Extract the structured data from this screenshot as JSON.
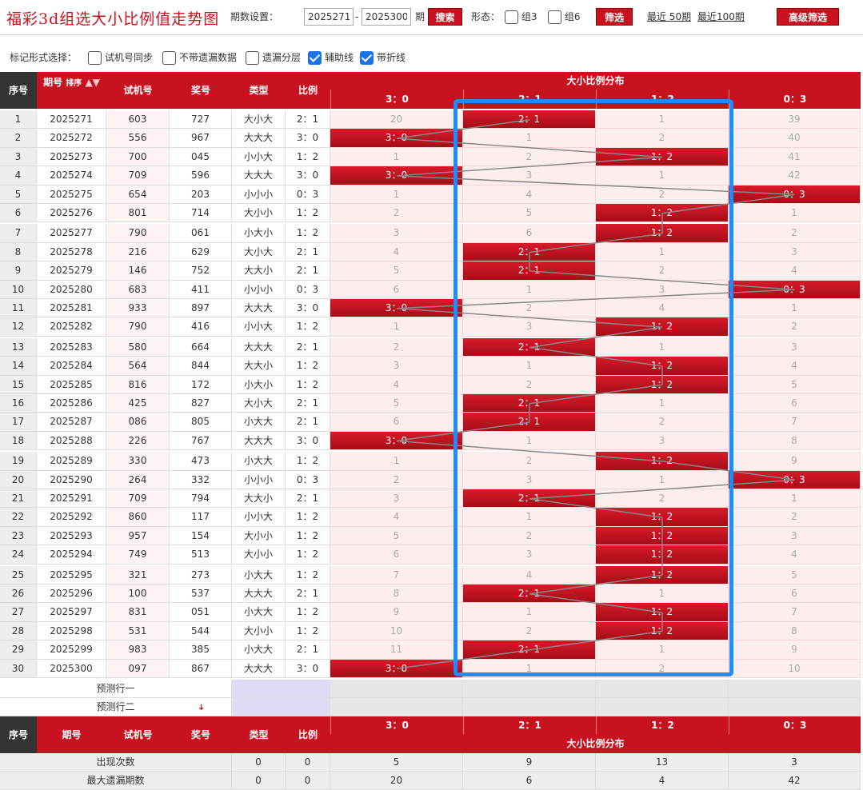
{
  "title": "福彩3d组选大小比例值走势图",
  "toolbar": {
    "period_label": "期数设置：",
    "from": "2025271",
    "to": "2025300",
    "period_suffix": "期",
    "search": "搜索",
    "form_label": "形态：",
    "group3": "组3",
    "group6": "组6",
    "filter": "筛选",
    "recent50": "最近 50期",
    "recent100": "最近100期",
    "advanced": "高级筛选"
  },
  "marks": {
    "label": "标记形式选择：",
    "opts": [
      {
        "label": "试机号同步",
        "checked": false
      },
      {
        "label": "不带遗漏数据",
        "checked": false
      },
      {
        "label": "遗漏分层",
        "checked": false
      },
      {
        "label": "辅助线",
        "checked": true
      },
      {
        "label": "带折线",
        "checked": true
      }
    ]
  },
  "header": {
    "seq": "序号",
    "period": "期号",
    "sort": "排序",
    "trial": "试机号",
    "prize": "奖号",
    "type": "类型",
    "ratio": "比例",
    "dist": "大小比例分布"
  },
  "ratios": [
    "3：0",
    "2：1",
    "1：2",
    "0：3"
  ],
  "rows": [
    [
      "1",
      "2025271",
      "603",
      "727",
      "大小大",
      "2：1",
      [
        20,
        -1,
        1,
        39
      ]
    ],
    [
      "2",
      "2025272",
      "556",
      "967",
      "大大大",
      "3：0",
      [
        -1,
        1,
        2,
        40
      ]
    ],
    [
      "3",
      "2025273",
      "700",
      "045",
      "小小大",
      "1：2",
      [
        1,
        2,
        -1,
        41
      ]
    ],
    [
      "4",
      "2025274",
      "709",
      "596",
      "大大大",
      "3：0",
      [
        -1,
        3,
        1,
        42
      ]
    ],
    [
      "5",
      "2025275",
      "654",
      "203",
      "小小小",
      "0：3",
      [
        1,
        4,
        2,
        -1
      ]
    ],
    [
      "6",
      "2025276",
      "801",
      "714",
      "大小小",
      "1：2",
      [
        2,
        5,
        -1,
        1
      ]
    ],
    [
      "7",
      "2025277",
      "790",
      "061",
      "小大小",
      "1：2",
      [
        3,
        6,
        -1,
        2
      ]
    ],
    [
      "8",
      "2025278",
      "216",
      "629",
      "大小大",
      "2：1",
      [
        4,
        -1,
        1,
        3
      ]
    ],
    [
      "9",
      "2025279",
      "146",
      "752",
      "大大小",
      "2：1",
      [
        5,
        -1,
        2,
        4
      ]
    ],
    [
      "10",
      "2025280",
      "683",
      "411",
      "小小小",
      "0：3",
      [
        6,
        1,
        3,
        -1
      ]
    ],
    [
      "11",
      "2025281",
      "933",
      "897",
      "大大大",
      "3：0",
      [
        -1,
        2,
        4,
        1
      ]
    ],
    [
      "12",
      "2025282",
      "790",
      "416",
      "小小大",
      "1：2",
      [
        1,
        3,
        -1,
        2
      ]
    ],
    [
      "13",
      "2025283",
      "580",
      "664",
      "大大大",
      "2：1",
      [
        2,
        -1,
        1,
        3
      ]
    ],
    [
      "14",
      "2025284",
      "564",
      "844",
      "大大小",
      "1：2",
      [
        3,
        1,
        -1,
        4
      ]
    ],
    [
      "15",
      "2025285",
      "816",
      "172",
      "小大小",
      "1：2",
      [
        4,
        2,
        -1,
        5
      ]
    ],
    [
      "16",
      "2025286",
      "425",
      "827",
      "大小大",
      "2：1",
      [
        5,
        -1,
        1,
        6
      ]
    ],
    [
      "17",
      "2025287",
      "086",
      "805",
      "小大大",
      "2：1",
      [
        6,
        -1,
        2,
        7
      ]
    ],
    [
      "18",
      "2025288",
      "226",
      "767",
      "大大大",
      "3：0",
      [
        -1,
        1,
        3,
        8
      ]
    ],
    [
      "19",
      "2025289",
      "330",
      "473",
      "小大大",
      "1：2",
      [
        1,
        2,
        -1,
        9
      ]
    ],
    [
      "20",
      "2025290",
      "264",
      "332",
      "小小小",
      "0：3",
      [
        2,
        3,
        1,
        -1
      ]
    ],
    [
      "21",
      "2025291",
      "709",
      "794",
      "大大小",
      "2：1",
      [
        3,
        -1,
        2,
        1
      ]
    ],
    [
      "22",
      "2025292",
      "860",
      "117",
      "小小大",
      "1：2",
      [
        4,
        1,
        -1,
        2
      ]
    ],
    [
      "23",
      "2025293",
      "957",
      "154",
      "大小小",
      "1：2",
      [
        5,
        2,
        -1,
        3
      ]
    ],
    [
      "24",
      "2025294",
      "749",
      "513",
      "大小小",
      "1：2",
      [
        6,
        3,
        -1,
        4
      ]
    ],
    [
      "25",
      "2025295",
      "321",
      "273",
      "小大大",
      "1：2",
      [
        7,
        4,
        -1,
        5
      ]
    ],
    [
      "26",
      "2025296",
      "100",
      "537",
      "大大大",
      "2：1",
      [
        8,
        -1,
        1,
        6
      ]
    ],
    [
      "27",
      "2025297",
      "831",
      "051",
      "小大大",
      "1：2",
      [
        9,
        1,
        -1,
        7
      ]
    ],
    [
      "28",
      "2025298",
      "531",
      "544",
      "大小小",
      "1：2",
      [
        10,
        2,
        -1,
        8
      ]
    ],
    [
      "29",
      "2025299",
      "983",
      "385",
      "小大大",
      "2：1",
      [
        11,
        -1,
        1,
        9
      ]
    ],
    [
      "30",
      "2025300",
      "097",
      "867",
      "大大大",
      "3：0",
      [
        -1,
        1,
        2,
        10
      ]
    ]
  ],
  "predict": [
    "预测行一",
    "预测行二"
  ],
  "stats": [
    {
      "label": "出现次数",
      "type": "0",
      "ratio": "0",
      "vals": [
        "5",
        "9",
        "13",
        "3"
      ]
    },
    {
      "label": "最大遗漏期数",
      "type": "0",
      "ratio": "0",
      "vals": [
        "20",
        "6",
        "4",
        "42"
      ]
    }
  ]
}
